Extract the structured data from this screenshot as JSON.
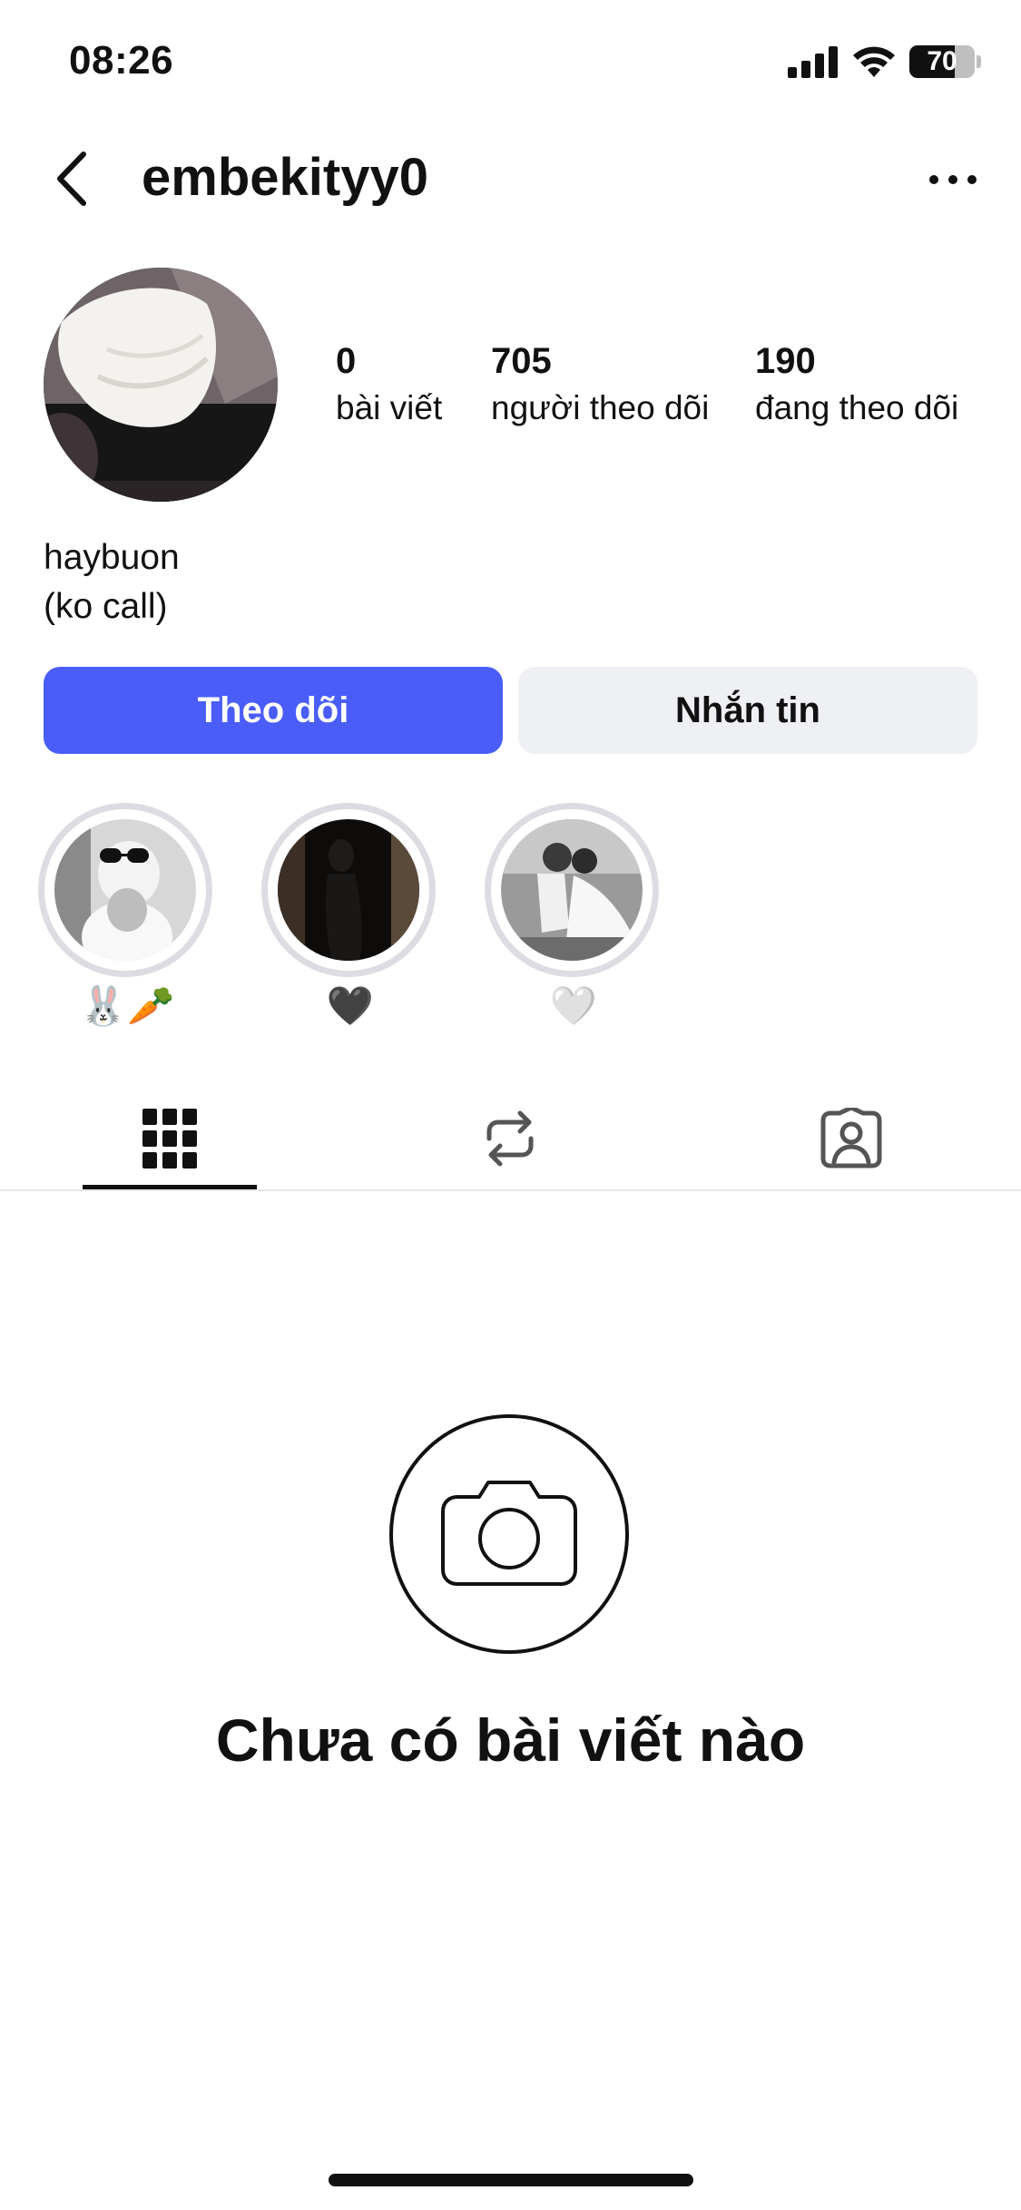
{
  "status_bar": {
    "time": "08:26",
    "battery_level": "70",
    "battery_fraction": 0.7
  },
  "header": {
    "username": "embekityy0",
    "back_icon": "chevron-left-icon",
    "more_icon": "ellipsis-icon"
  },
  "profile": {
    "stats": [
      {
        "value": "0",
        "label": "bài viết"
      },
      {
        "value": "705",
        "label": "người theo dõi"
      },
      {
        "value": "190",
        "label": "đang theo dõi"
      }
    ],
    "bio_line1": "haybuon",
    "bio_line2": "(ko call)"
  },
  "actions": {
    "follow_label": "Theo dõi",
    "message_label": "Nhắn tin"
  },
  "highlights": [
    {
      "label": "🐰🥕"
    },
    {
      "label": "🖤"
    },
    {
      "label": "🤍"
    }
  ],
  "tabs": [
    {
      "name": "posts-grid",
      "icon": "grid-icon",
      "active": true
    },
    {
      "name": "reposts",
      "icon": "repost-icon",
      "active": false
    },
    {
      "name": "tagged",
      "icon": "tagged-person-icon",
      "active": false
    }
  ],
  "empty_state": {
    "icon": "camera-icon",
    "title": "Chưa có bài viết nào"
  },
  "colors": {
    "accent": "#4a5df9",
    "secondary_button": "#eff0f4",
    "text": "#111111"
  }
}
